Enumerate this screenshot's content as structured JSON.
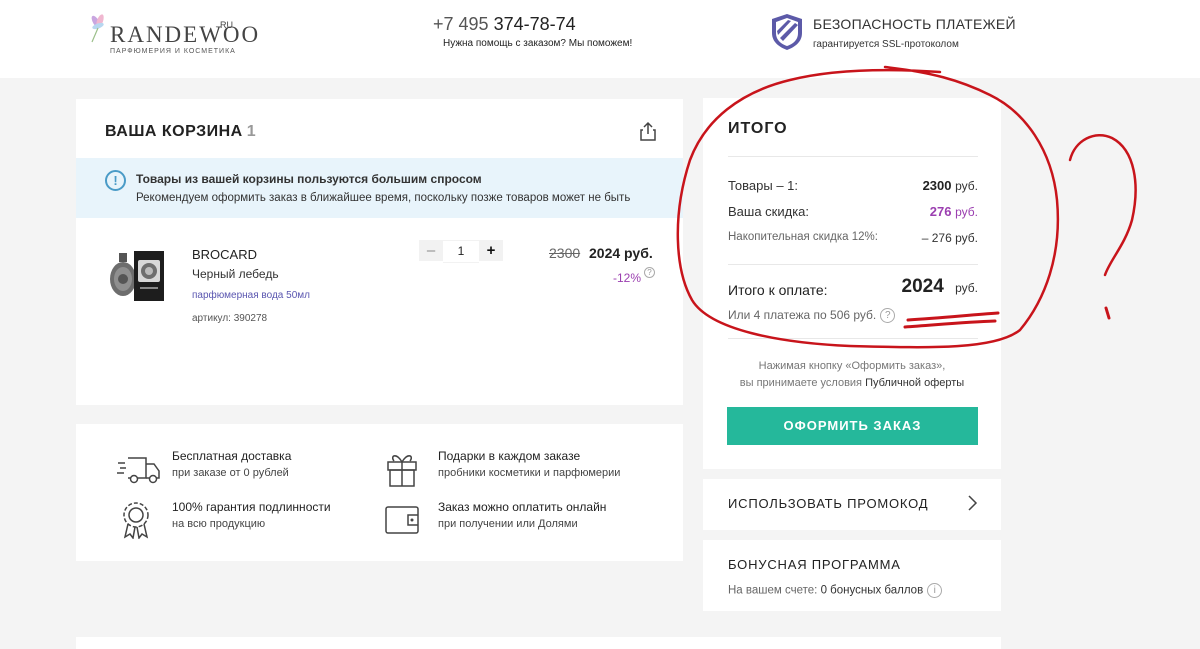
{
  "header": {
    "logo_text": "RANDEWOO",
    "logo_suffix": "RU",
    "logo_tagline": "ПАРФЮМЕРИЯ И КОСМЕТИКА",
    "phone_prefix": "+7 495",
    "phone_number": "374-78-74",
    "help_text": "Нужна помощь с заказом? Мы поможем!",
    "security_title": "БЕЗОПАСНОСТЬ ПЛАТЕЖЕЙ",
    "security_sub": "гарантируется SSL-протоколом"
  },
  "cart": {
    "title": "ВАША КОРЗИНА",
    "count": "1",
    "notice_title": "Товары из вашей корзины пользуются большим спросом",
    "notice_text": "Рекомендуем оформить заказ в ближайшее время, поскольку позже товаров может не быть",
    "item": {
      "brand": "BROCARD",
      "name": "Черный лебедь",
      "type": "парфюмерная вода 50мл",
      "article": "артикул: 390278",
      "quantity": "1",
      "qty_minus": "–",
      "qty_plus": "+",
      "old_price": "2300",
      "new_price": "2024 руб.",
      "discount": "-12%"
    }
  },
  "features": [
    {
      "title": "Бесплатная доставка",
      "sub": "при заказе от 0 рублей",
      "icon": "truck-icon"
    },
    {
      "title": "Подарки в каждом заказе",
      "sub": "пробники косметики и парфюмерии",
      "icon": "gift-icon"
    },
    {
      "title": "100% гарантия подлинности",
      "sub": "на всю продукцию",
      "icon": "award-icon"
    },
    {
      "title": "Заказ можно оплатить онлайн",
      "sub": "при получении или Долями",
      "icon": "wallet-icon"
    }
  ],
  "summary": {
    "title": "ИТОГО",
    "items_label": "Товары – 1:",
    "items_value": "2300",
    "discount_label": "Ваша скидка:",
    "discount_value": "276",
    "cumulative_label": "Накопительная скидка 12%:",
    "cumulative_value": "– 276 руб.",
    "currency": "руб.",
    "total_label": "Итого к оплате:",
    "total_value": "2024",
    "installments": "Или 4 платежа по 506 руб.",
    "terms_line1": "Нажимая кнопку «Оформить заказ»,",
    "terms_line2_prefix": "вы принимаете условия",
    "terms_link": "Публичной оферты",
    "order_button": "ОФОРМИТЬ ЗАКАЗ"
  },
  "promo": {
    "label": "ИСПОЛЬЗОВАТЬ ПРОМОКОД"
  },
  "bonus": {
    "title": "БОНУСНАЯ ПРОГРАММА",
    "account_label": "На вашем счете:",
    "account_value": "0 бонусных баллов"
  },
  "colors": {
    "accent_green": "#25b89b",
    "discount_purple": "#9b3fb0",
    "notice_bg": "#e8f4fb",
    "annotation_red": "#c8141b"
  }
}
